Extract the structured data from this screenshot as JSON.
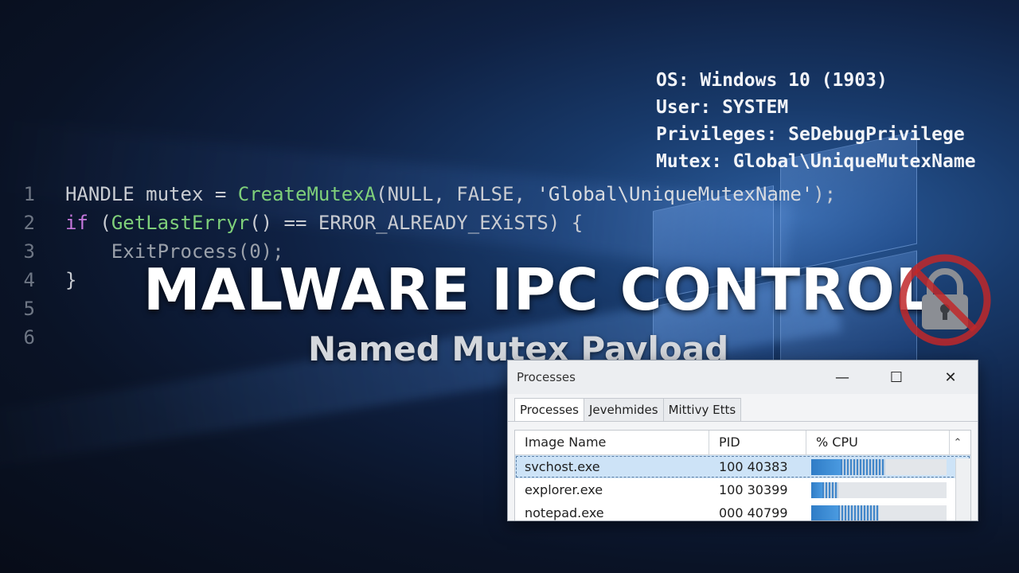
{
  "sysinfo": [
    "OS: Windows 10 (1903)",
    "User: SYSTEM",
    "Privileges: SeDebugPrivilege",
    "Mutex: Global\\UniqueMutexName"
  ],
  "code": {
    "line_numbers": [
      "1",
      "2",
      "3",
      "4",
      "5",
      "6"
    ],
    "lines": [
      [
        {
          "t": "HANDLE mutex = ",
          "c": "plain"
        },
        {
          "t": "CreateMutexA",
          "c": "fn"
        },
        {
          "t": "(NULL, FALSE, ",
          "c": "plain"
        },
        {
          "t": "'Global\\UniqueMutexName'",
          "c": "str"
        },
        {
          "t": ");",
          "c": "plain"
        }
      ],
      [
        {
          "t": "if",
          "c": "kw"
        },
        {
          "t": " (",
          "c": "plain"
        },
        {
          "t": "GetLastErryr",
          "c": "fn"
        },
        {
          "t": "() == ERROR_ALREADY_EXiSTS) {",
          "c": "plain"
        }
      ],
      [
        {
          "t": "    ExitProcess(0);",
          "c": "dim"
        }
      ],
      [
        {
          "t": "}",
          "c": "plain"
        }
      ],
      [],
      []
    ]
  },
  "title": "MALWARE IPC CONTROL",
  "subtitle": "Named Mutex Payload",
  "icons": {
    "lock": "prohibited-lock-icon",
    "window_logo": "windows-logo-icon"
  },
  "task_manager": {
    "title": "Processes",
    "controls": {
      "minimize": "—",
      "maximize": "☐",
      "close": "✕"
    },
    "tabs": [
      "Processes",
      "Jevehmides",
      "Mittivy Etts"
    ],
    "active_tab": 0,
    "columns": [
      "Image Name",
      "PID",
      "% CPU"
    ],
    "rows": [
      {
        "name": "svchost.exe",
        "pid": "100 40383",
        "cpu": 0.55,
        "selected": true
      },
      {
        "name": "explorer.exe",
        "pid": "100 30399",
        "cpu": 0.2,
        "selected": false
      },
      {
        "name": "notepad.exe",
        "pid": "000 40799",
        "cpu": 0.5,
        "selected": false
      }
    ]
  },
  "colors": {
    "function": "#7fd07a",
    "keyword": "#c678dd",
    "prohibited": "#c0282a",
    "selection": "#cde3f7",
    "cpu_bar": "#2f7cc6"
  }
}
